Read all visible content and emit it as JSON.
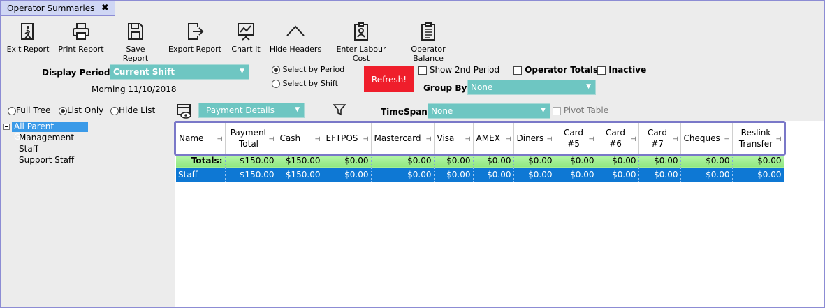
{
  "tab": {
    "label": "Operator Summaries",
    "close": "✖"
  },
  "toolbar": [
    {
      "label": "Exit Report",
      "icon": "exit-icon"
    },
    {
      "label": "Print Report",
      "icon": "printer-icon"
    },
    {
      "label": "Save Report",
      "icon": "save-icon"
    },
    {
      "label": "Export Report",
      "icon": "export-icon"
    },
    {
      "label": "Chart It",
      "icon": "chart-icon"
    },
    {
      "label": "Hide Headers",
      "icon": "chevron-up-icon"
    },
    {
      "label": "Enter Labour Cost",
      "icon": "badge-icon"
    },
    {
      "label": "Operator Balance",
      "icon": "clipboard-icon"
    }
  ],
  "display_period": {
    "label": "Display Period:",
    "value": "Current Shift",
    "subtext": "Morning 11/10/2018"
  },
  "select_mode": {
    "by_period": "Select by Period",
    "by_shift": "Select by Shift"
  },
  "refresh_label": "Refresh!",
  "options": {
    "show_2nd_period": "Show 2nd Period",
    "operator_totals": "Operator Totals",
    "inactive": "Inactive"
  },
  "group_by": {
    "label": "Group By:",
    "value": "None"
  },
  "tree_mode": {
    "full": "Full Tree",
    "list": "List Only",
    "hide": "Hide List"
  },
  "layout_dropdown": {
    "value": "_Payment Details"
  },
  "timespan": {
    "label": "TimeSpan:",
    "value": "None"
  },
  "pivot_label": "Pivot Table",
  "tree": {
    "root": "All Parent Groups",
    "children": [
      "Management",
      "Staff",
      "Support Staff"
    ]
  },
  "table": {
    "columns": [
      [
        "Name"
      ],
      [
        "Payment",
        "Total"
      ],
      [
        "Cash"
      ],
      [
        "EFTPOS"
      ],
      [
        "Mastercard"
      ],
      [
        "Visa"
      ],
      [
        "AMEX"
      ],
      [
        "Diners"
      ],
      [
        "Card",
        "#5"
      ],
      [
        "Card",
        "#6"
      ],
      [
        "Card",
        "#7"
      ],
      [
        "Cheques"
      ],
      [
        "Reslink",
        "Transfer"
      ]
    ],
    "totals": [
      "Totals:",
      "$150.00",
      "$150.00",
      "$0.00",
      "$0.00",
      "$0.00",
      "$0.00",
      "$0.00",
      "$0.00",
      "$0.00",
      "$0.00",
      "$0.00",
      "$0.00"
    ],
    "rows": [
      [
        "Staff",
        "$150.00",
        "$150.00",
        "$0.00",
        "$0.00",
        "$0.00",
        "$0.00",
        "$0.00",
        "$0.00",
        "$0.00",
        "$0.00",
        "$0.00",
        "$0.00"
      ]
    ]
  },
  "colors": {
    "teal": "#6ec6c2",
    "refresh": "#ef1e2b",
    "selected_row": "#0e78d4",
    "totals_row": "#a4ef97"
  }
}
